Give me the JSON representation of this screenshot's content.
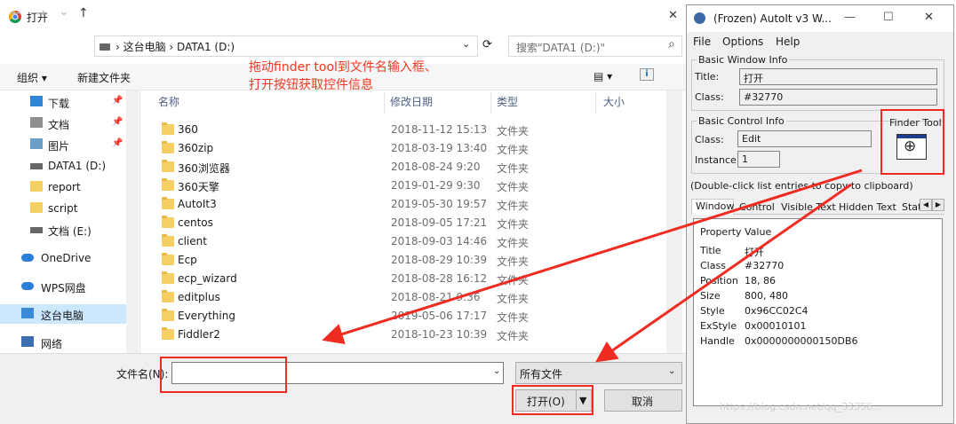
{
  "dialog": {
    "title": "打开",
    "close_glyph": "✕",
    "nav": {
      "back": "←",
      "forward": "→",
      "recent": "⌄",
      "up": "↑"
    },
    "address": {
      "path": "› 这台电脑 › DATA1 (D:)",
      "dropdown": "⌄",
      "refresh": "⟳"
    },
    "search_placeholder": "搜索\"DATA1 (D:)\"",
    "search_glyph": "⌕",
    "toolbar": {
      "organize": "组织 ▾",
      "new_folder": "新建文件夹",
      "view": "▤ ▾"
    },
    "sidebar": [
      {
        "label": "下载",
        "icon": "download-icon",
        "pinned": true
      },
      {
        "label": "文档",
        "icon": "document-icon",
        "pinned": true
      },
      {
        "label": "图片",
        "icon": "picture-icon",
        "pinned": true
      },
      {
        "label": "DATA1 (D:)",
        "icon": "drive-icon",
        "pinned": false
      },
      {
        "label": "report",
        "icon": "folder-icon",
        "pinned": false
      },
      {
        "label": "script",
        "icon": "folder-icon",
        "pinned": false
      },
      {
        "label": "文档 (E:)",
        "icon": "drive-icon",
        "pinned": false
      },
      {
        "label": "OneDrive",
        "icon": "cloud-icon",
        "pinned": false
      },
      {
        "label": "WPS网盘",
        "icon": "cloud-icon",
        "pinned": false
      },
      {
        "label": "这台电脑",
        "icon": "computer-icon",
        "pinned": false,
        "selected": true
      },
      {
        "label": "网络",
        "icon": "network-icon",
        "pinned": false
      }
    ],
    "pin_glyph": "📌",
    "columns": {
      "name": "名称",
      "date": "修改日期",
      "type": "类型",
      "size": "大小"
    },
    "files": [
      {
        "name": "360",
        "date": "2018-11-12 15:13",
        "type": "文件夹"
      },
      {
        "name": "360zip",
        "date": "2018-03-19 13:40",
        "type": "文件夹"
      },
      {
        "name": "360浏览器",
        "date": "2018-08-24 9:20",
        "type": "文件夹"
      },
      {
        "name": "360天擎",
        "date": "2019-01-29 9:30",
        "type": "文件夹"
      },
      {
        "name": "AutoIt3",
        "date": "2019-05-30 19:57",
        "type": "文件夹"
      },
      {
        "name": "centos",
        "date": "2018-09-05 17:21",
        "type": "文件夹"
      },
      {
        "name": "client",
        "date": "2018-09-03 14:46",
        "type": "文件夹"
      },
      {
        "name": "Ecp",
        "date": "2018-08-29 10:39",
        "type": "文件夹"
      },
      {
        "name": "ecp_wizard",
        "date": "2018-08-28 16:12",
        "type": "文件夹"
      },
      {
        "name": "editplus",
        "date": "2018-08-21 9:36",
        "type": "文件夹"
      },
      {
        "name": "Everything",
        "date": "2019-05-06 17:17",
        "type": "文件夹"
      },
      {
        "name": "Fiddler2",
        "date": "2018-10-23 10:39",
        "type": "文件夹"
      }
    ],
    "filename_label": "文件名(N):",
    "filename_value": "",
    "filetype_value": "所有文件",
    "open_label": "打开(O)",
    "cancel_label": "取消"
  },
  "autoit": {
    "title": "(Frozen) AutoIt v3 W...",
    "controls": {
      "min": "—",
      "max": "☐",
      "close": "✕"
    },
    "menu": [
      "File",
      "Options",
      "Help"
    ],
    "basic_window_info": "Basic Window Info",
    "title_label": "Title:",
    "title_value": "打开",
    "class_label": "Class:",
    "class_value": "#32770",
    "basic_control_info": "Basic Control Info",
    "ctrl_class_label": "Class:",
    "ctrl_class_value": "Edit",
    "instance_label": "Instance:",
    "instance_value": "1",
    "finder_tool": "Finder Tool",
    "finder_glyph": "⊕",
    "hint": "(Double-click list entries to copy to clipboard)",
    "tabs": [
      "Window",
      "Control",
      "Visible Text",
      "Hidden Text",
      "Stat"
    ],
    "tab_arrows": {
      "left": "◀",
      "right": "▶"
    },
    "prop_header": "Property",
    "val_header": "Value",
    "props": [
      {
        "p": "Title",
        "v": "打开"
      },
      {
        "p": "Class",
        "v": "#32770"
      },
      {
        "p": "Position",
        "v": "18, 86"
      },
      {
        "p": "Size",
        "v": "800, 480"
      },
      {
        "p": "Style",
        "v": "0x96CC02C4"
      },
      {
        "p": "ExStyle",
        "v": "0x00010101"
      },
      {
        "p": "Handle",
        "v": "0x0000000000150DB6"
      }
    ]
  },
  "annotation": {
    "line1": "拖动finder tool到文件名输入框、",
    "line2": "打开按钮获取控件信息"
  },
  "watermark": "https://blog.csdn.net/qq_33356..."
}
